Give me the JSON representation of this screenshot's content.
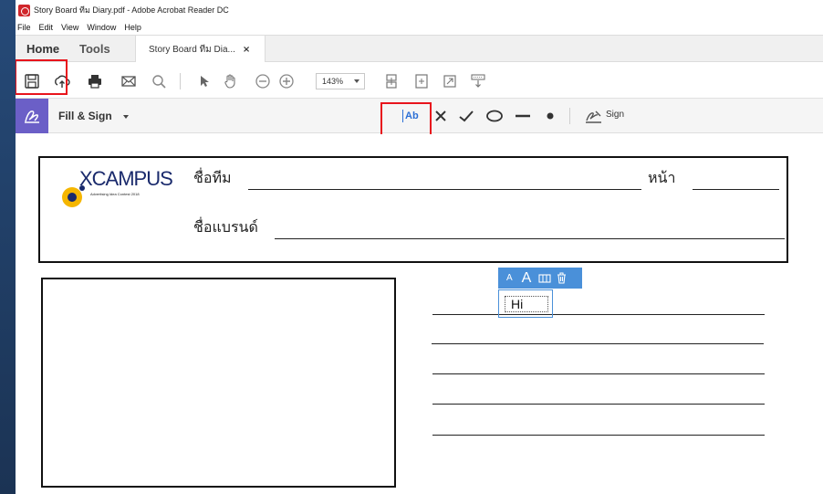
{
  "window": {
    "title": "Story Board ทีม Diary.pdf - Adobe Acrobat Reader DC"
  },
  "menubar": {
    "items": [
      "File",
      "Edit",
      "View",
      "Window",
      "Help"
    ]
  },
  "tabs": {
    "home": "Home",
    "tools": "Tools",
    "doc_tab_label": "Story Board ทีม Dia...",
    "close_glyph": "×"
  },
  "toolbar": {
    "zoom_value": "143%",
    "icons": [
      "save-icon",
      "cloud-upload-icon",
      "print-icon",
      "email-icon",
      "search-icon",
      "select-arrow-icon",
      "hand-icon",
      "zoom-out-icon",
      "zoom-in-icon",
      "fit-page-icon",
      "full-screen-icon",
      "rotate-icon",
      "scroll-mode-icon"
    ]
  },
  "fill_sign": {
    "label": "Fill & Sign",
    "text_tool_label": "Ab",
    "sign_label": "Sign",
    "tools": [
      "add-text-icon",
      "cross-icon",
      "checkmark-icon",
      "circle-icon",
      "line-icon",
      "dot-icon",
      "sign-icon"
    ]
  },
  "document": {
    "logo_word": "XCAMPUS",
    "logo_sub": "Advertising Idea Contest 2018",
    "team_label": "ชื่อทีม",
    "page_label": "หน้า",
    "brand_label": "ชื่อแบรนด์"
  },
  "text_field": {
    "small_a": "A",
    "big_a": "A",
    "value": "Hi"
  },
  "colors": {
    "accent_blue": "#4a90d9",
    "fill_sign_purple": "#6b5fc7",
    "highlight_red": "#e8141c"
  }
}
